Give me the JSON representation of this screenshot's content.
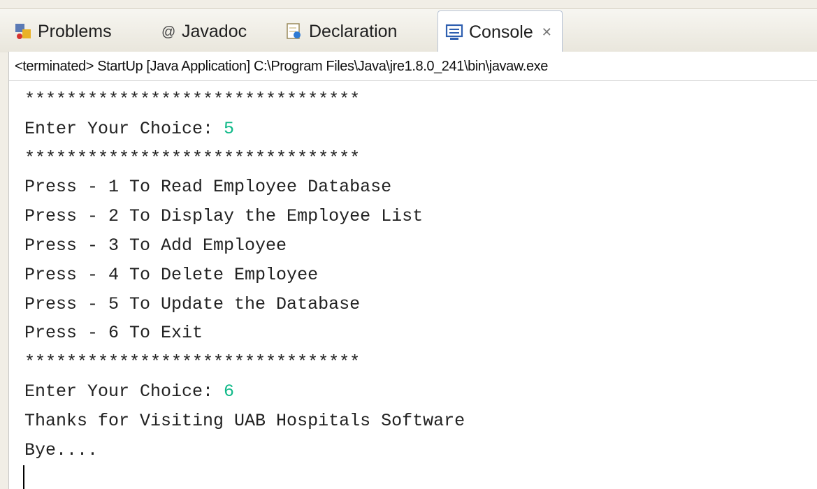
{
  "tabs": [
    {
      "label": "Problems",
      "icon": "problems-icon"
    },
    {
      "label": "Javadoc",
      "icon": "at-icon"
    },
    {
      "label": "Declaration",
      "icon": "declaration-icon"
    },
    {
      "label": "Console",
      "icon": "console-icon",
      "active": true
    }
  ],
  "close_glyph": "✕",
  "status_text": "<terminated> StartUp [Java Application] C:\\Program Files\\Java\\jre1.8.0_241\\bin\\javaw.exe",
  "console": {
    "stars1": "********************************",
    "prompt1": "Enter Your Choice: ",
    "choice1": "5",
    "stars2": "********************************",
    "menu1": "Press - 1 To Read Employee Database",
    "menu2": "Press - 2 To Display the Employee List",
    "menu3": "Press - 3 To Add Employee",
    "menu4": "Press - 4 To Delete Employee",
    "menu5": "Press - 5 To Update the Database",
    "menu6": "Press - 6 To Exit",
    "stars3": "********************************",
    "prompt2": "Enter Your Choice: ",
    "choice2": "6",
    "thanks": "Thanks for Visiting UAB Hospitals Software",
    "bye": "Bye...."
  },
  "colors": {
    "input_text": "#11b989",
    "active_tab_border": "#b9c4d6"
  }
}
